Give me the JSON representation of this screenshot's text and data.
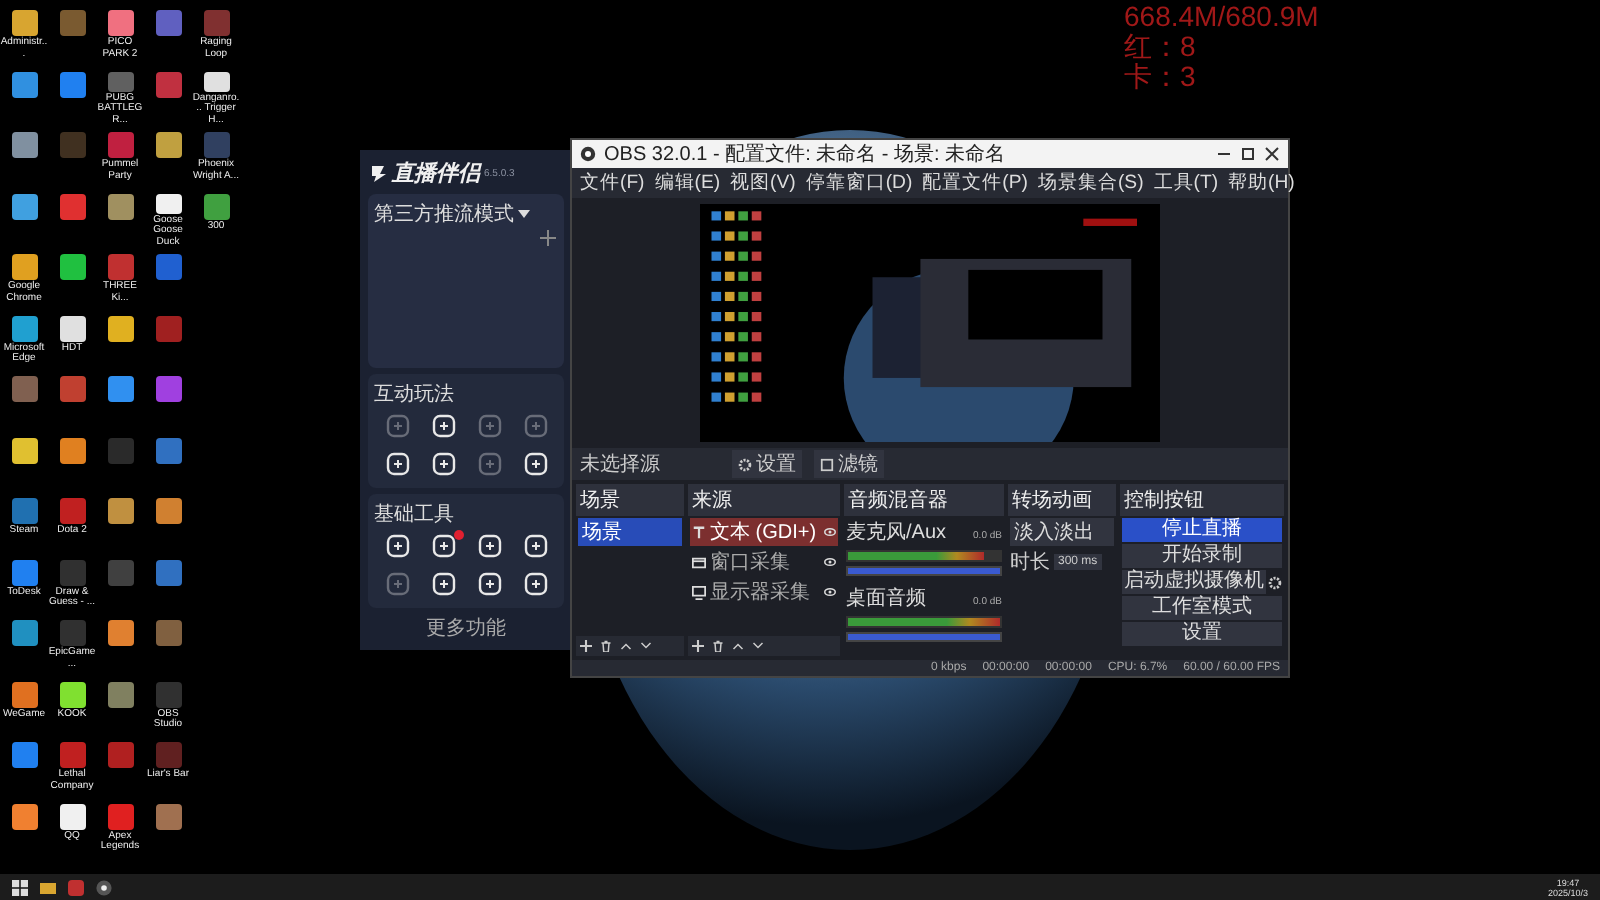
{
  "overlay": {
    "lines": [
      "668.4M/680.9M",
      "红：8",
      "卡：3"
    ]
  },
  "desktop_rows": [
    [
      {
        "label": "Administr...",
        "color": "#d8a530"
      },
      {
        "color": "#7a5a30"
      },
      {
        "label": "PICO PARK 2",
        "color": "#f07080"
      },
      {
        "color": "#6060c0"
      },
      {
        "label": "Raging Loop",
        "color": "#803030"
      }
    ],
    [
      {
        "color": "#3090e0"
      },
      {
        "color": "#2080f0"
      },
      {
        "label": "PUBG BATTLEGR...",
        "color": "#606060"
      },
      {
        "color": "#c03040"
      },
      {
        "label": "Danganro... Trigger H...",
        "color": "#e0e0e0"
      }
    ],
    [
      {
        "color": "#8090a0"
      },
      {
        "color": "#403020"
      },
      {
        "label": "Pummel Party",
        "color": "#c02040"
      },
      {
        "color": "#c0a040"
      },
      {
        "label": "Phoenix Wright A...",
        "color": "#304060"
      }
    ],
    [
      {
        "color": "#40a0e0"
      },
      {
        "color": "#e03030"
      },
      {
        "color": "#a09060"
      },
      {
        "label": "Goose Goose Duck",
        "color": "#f0f0f0"
      },
      {
        "label": "300",
        "color": "#40a040"
      }
    ],
    [
      {
        "label": "Google Chrome",
        "color": "#e0a020"
      },
      {
        "color": "#20c040"
      },
      {
        "label": "THREE Ki...",
        "color": "#c03030"
      },
      {
        "color": "#2060d0"
      }
    ],
    [
      {
        "label": "Microsoft Edge",
        "color": "#20a0d0"
      },
      {
        "label": "HDT",
        "color": "#e0e0e0"
      },
      {
        "color": "#e0b020"
      },
      {
        "color": "#a02020"
      }
    ],
    [
      {
        "color": "#806050"
      },
      {
        "color": "#c04030"
      },
      {
        "color": "#3090f0"
      },
      {
        "color": "#a040e0"
      }
    ],
    [
      {
        "color": "#e0c030"
      },
      {
        "color": "#e08020"
      },
      {
        "color": "#2a2a2a"
      },
      {
        "color": "#3070c0"
      }
    ],
    [
      {
        "label": "Steam",
        "color": "#2070b0"
      },
      {
        "label": "Dota 2",
        "color": "#c02020"
      },
      {
        "color": "#c09040"
      },
      {
        "color": "#d08030"
      }
    ],
    [
      {
        "label": "ToDesk",
        "color": "#2080f0"
      },
      {
        "label": "Draw & Guess - ...",
        "color": "#303030"
      },
      {
        "color": "#404040"
      },
      {
        "color": "#3070c0"
      }
    ],
    [
      {
        "color": "#2090c0"
      },
      {
        "label": "EpicGame...",
        "color": "#303030"
      },
      {
        "color": "#e08030"
      },
      {
        "color": "#806040"
      }
    ],
    [
      {
        "label": "WeGame",
        "color": "#e07020"
      },
      {
        "label": "KOOK",
        "color": "#80e030"
      },
      {
        "color": "#808060"
      },
      {
        "label": "OBS Studio",
        "color": "#303030"
      }
    ],
    [
      {
        "color": "#2080f0"
      },
      {
        "label": "Lethal Company",
        "color": "#c02020"
      },
      {
        "color": "#b02020"
      },
      {
        "label": "Liar's Bar",
        "color": "#602020"
      }
    ],
    [
      {
        "color": "#f08030"
      },
      {
        "label": "QQ",
        "color": "#f0f0f0"
      },
      {
        "label": "Apex Legends",
        "color": "#e02020"
      },
      {
        "color": "#a07050"
      }
    ]
  ],
  "companion": {
    "app_name": "直播伴侣",
    "version": "6.5.0.3",
    "mode": "第三方推流模式",
    "sections": [
      {
        "title": "互动玩法",
        "tools": [
          {
            "disabled": true,
            "notify": false
          },
          {
            "disabled": false,
            "notify": false
          },
          {
            "disabled": true,
            "notify": false
          },
          {
            "disabled": true,
            "notify": false
          },
          {
            "disabled": false,
            "notify": false
          },
          {
            "disabled": false,
            "notify": false
          },
          {
            "disabled": true,
            "notify": false
          },
          {
            "disabled": false,
            "notify": false
          }
        ]
      },
      {
        "title": "基础工具",
        "tools": [
          {
            "disabled": false,
            "notify": false
          },
          {
            "disabled": false,
            "notify": true
          },
          {
            "disabled": false,
            "notify": false
          },
          {
            "disabled": false,
            "notify": false
          },
          {
            "disabled": true,
            "notify": false
          },
          {
            "disabled": false,
            "notify": false
          },
          {
            "disabled": false,
            "notify": false
          },
          {
            "disabled": false,
            "notify": false
          }
        ]
      }
    ],
    "more": "更多功能"
  },
  "obs": {
    "title": "OBS 32.0.1 - 配置文件: 未命名 - 场景: 未命名",
    "menu": [
      "文件(F)",
      "编辑(E)",
      "视图(V)",
      "停靠窗口(D)",
      "配置文件(P)",
      "场景集合(S)",
      "工具(T)",
      "帮助(H)"
    ],
    "source_bar": {
      "label": "未选择源",
      "buttons": [
        {
          "kind": "properties",
          "label": "设置"
        },
        {
          "kind": "filters",
          "label": "滤镜"
        }
      ]
    },
    "scenes": {
      "title": "场景",
      "items": [
        {
          "label": "场景",
          "selected": true
        }
      ]
    },
    "sources": {
      "title": "来源",
      "items": [
        {
          "kind": "text",
          "label": "文本 (GDI+)",
          "selected": true
        },
        {
          "kind": "window",
          "label": "窗口采集",
          "selected": false
        },
        {
          "kind": "display",
          "label": "显示器采集",
          "selected": false
        }
      ]
    },
    "mixer": {
      "title": "音频混音器",
      "channels": [
        {
          "name": "麦克风/Aux",
          "reading": "0.0 dB",
          "meter": {
            "level": 0.9
          },
          "fader": {
            "level": 1
          }
        },
        {
          "name": "桌面音频",
          "reading": "0.0 dB",
          "meter": {
            "level": 1
          },
          "fader": {
            "level": 1
          }
        }
      ]
    },
    "transitions": {
      "title": "转场动画",
      "type": "淡入淡出",
      "duration_label": "时长",
      "duration": "300 ms"
    },
    "controls": {
      "title": "控制按钮",
      "buttons": [
        {
          "label": "停止直播",
          "active": true,
          "settings": false
        },
        {
          "label": "开始录制",
          "active": false,
          "settings": false
        },
        {
          "label": "启动虚拟摄像机",
          "active": false,
          "settings": true
        },
        {
          "label": "工作室模式",
          "active": false,
          "settings": false
        },
        {
          "label": "设置",
          "active": false,
          "settings": false
        }
      ]
    },
    "status": [
      "0 kbps",
      "00:00:00",
      "00:00:00",
      "CPU: 6.7%",
      "60.00 / 60.00 FPS"
    ]
  },
  "taskbar": {
    "time": "19:47",
    "date": "2025/10/3"
  }
}
